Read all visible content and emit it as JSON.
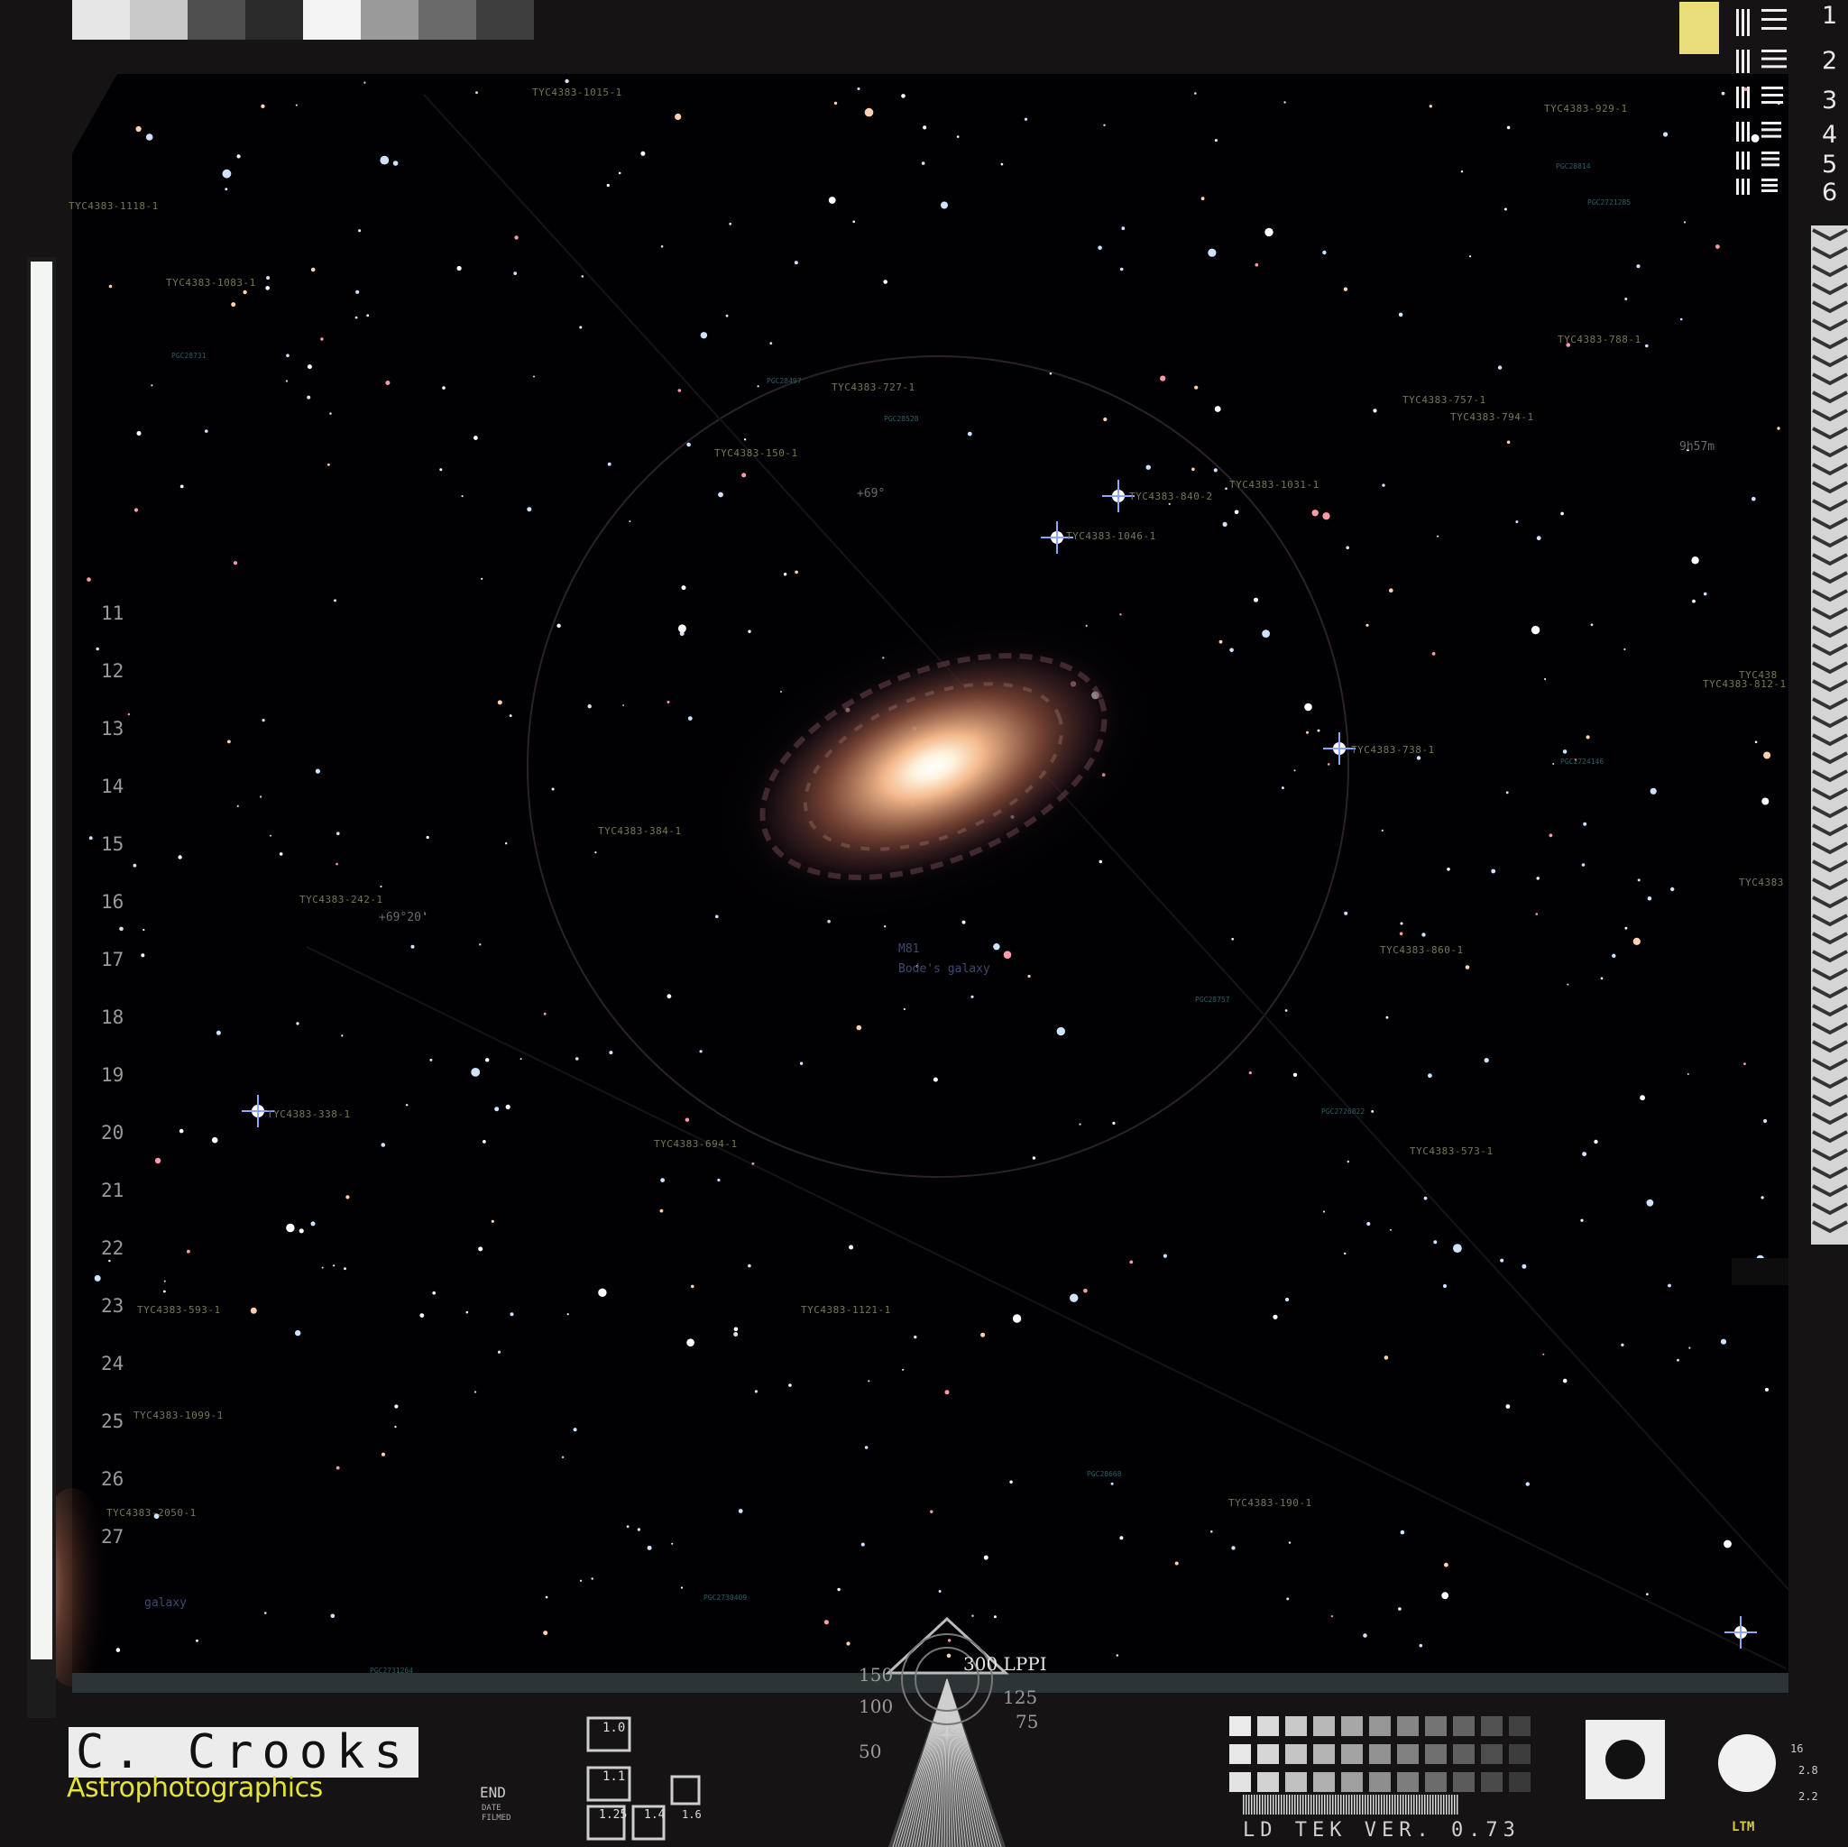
{
  "logo": {
    "name": "C. Crooks",
    "tagline": "Astrophotographics"
  },
  "resolution_chart": {
    "numbers": [
      "1",
      "2",
      "3",
      "4",
      "5",
      "6"
    ],
    "colors": {
      "yellow_swatch": "#e8dd7a"
    }
  },
  "left_ruler": {
    "numbers": [
      "11",
      "12",
      "13",
      "14",
      "15",
      "16",
      "17",
      "18",
      "19",
      "20",
      "21",
      "22",
      "23",
      "24",
      "25",
      "26",
      "27"
    ]
  },
  "bottom_gauge": {
    "lppi_label": "300 LPPI",
    "scale_left": [
      "150",
      "100",
      "50"
    ],
    "scale_right": [
      "125",
      "75"
    ]
  },
  "bottom_chart": {
    "small_labels": [
      "END",
      "DATE",
      "FILMED"
    ],
    "scale_labels": [
      "1.0",
      "1.1",
      "1.25",
      "1.4",
      "1.6"
    ],
    "version": "LD TEK VER. 0.73",
    "right_small": [
      "16",
      "2.8",
      "2.2"
    ],
    "corner_mark": "LTM"
  },
  "coordinates": {
    "dec_top": "+69°",
    "dec_mid": "+69°20'",
    "ra_right": "9h57m"
  },
  "target": {
    "name": "M81",
    "alias": "Bode's galaxy",
    "neighbor": "galaxy"
  },
  "star_labels": [
    "TYC4383-1015-1",
    "TYC4383-929-1",
    "TYC4383-1118-1",
    "TYC4383-1083-1",
    "TYC4383-788-1",
    "TYC4383-727-1",
    "TYC4383-757-1",
    "TYC4383-794-1",
    "TYC4383-150-1",
    "TYC4383-840-2",
    "TYC4383-1031-1",
    "TYC4383-1046-1",
    "TYC4383-812-1",
    "TYC4383-738-1",
    "TYC4383-384-1",
    "TYC4383-242-1",
    "TYC4383-860-1",
    "TYC4383-338-1",
    "TYC4383-694-1",
    "TYC4383-573-1",
    "TYC4383-593-1",
    "TYC4383-1121-1",
    "TYC4383-1099-1",
    "TYC4383-2050-1",
    "TYC4383-190-1",
    "TYC438",
    "TYC4383"
  ],
  "pgc_labels": [
    "PGC28814",
    "PGC2721285",
    "PGC28731",
    "PGC28497",
    "PGC28528",
    "PGC2724146",
    "PGC28757",
    "PGC2726822",
    "PGC28668",
    "PGC2730409",
    "PGC2731264"
  ]
}
